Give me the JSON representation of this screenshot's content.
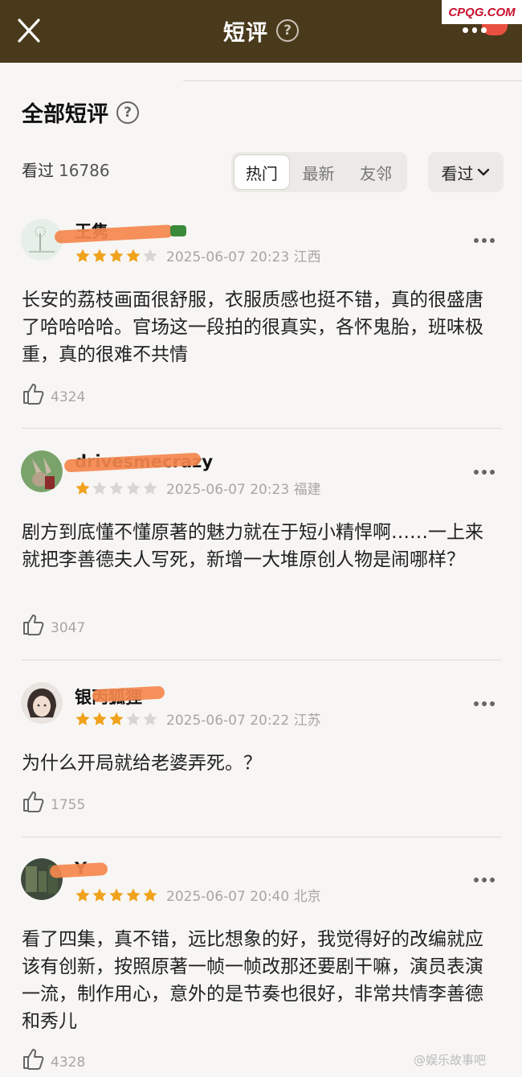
{
  "header": {
    "title": "短评",
    "help_symbol": "?",
    "close_icon": "close-icon",
    "more_icon": "more-icon",
    "background": "#4a3a1c"
  },
  "watermark_top": "CPQG.COM",
  "section": {
    "title": "全部短评",
    "help_symbol": "?"
  },
  "count": {
    "label": "看过",
    "value": "16786"
  },
  "tabs": [
    {
      "label": "热门",
      "active": true
    },
    {
      "label": "最新",
      "active": false
    },
    {
      "label": "友邻",
      "active": false
    }
  ],
  "filter": {
    "label": "看过",
    "icon": "chevron-down-icon"
  },
  "reviews": [
    {
      "username": "王隽",
      "rating": 4,
      "time": "2025-06-07 20:23 江西",
      "text": "长安的荔枝画面很舒服，衣服质感也挺不错，真的很盛唐了哈哈哈哈。官场这一段拍的很真实，各怀鬼胎，班味极重，真的很难不共情",
      "likes": "4324"
    },
    {
      "username": "drivesmecrazy",
      "rating": 1,
      "time": "2025-06-07 20:23 福建",
      "text": "剧方到底懂不懂原著的魅力就在于短小精悍啊……一上来就把李善德夫人写死，新增一大堆原创人物是闹哪样？",
      "likes": "3047"
    },
    {
      "username": "银丙狐狸",
      "rating": 3,
      "time": "2025-06-07 20:22 江苏",
      "text": "为什么开局就给老婆弄死。？",
      "likes": "1755"
    },
    {
      "username": "Y",
      "rating": 5,
      "time": "2025-06-07 20:40 北京",
      "text": "看了四集，真不错，远比想象的好，我觉得好的改编就应该有创新，按照原著一帧一帧改那还要剧干嘛，演员表演一流，制作用心，意外的是节奏也很好，非常共情李善德和秀儿",
      "likes": "4328"
    }
  ],
  "watermark_bottom": "@娱乐故事吧",
  "colors": {
    "star_on": "#f0a21d",
    "star_off": "#d8d6d2",
    "scribble": "#f4874d"
  }
}
